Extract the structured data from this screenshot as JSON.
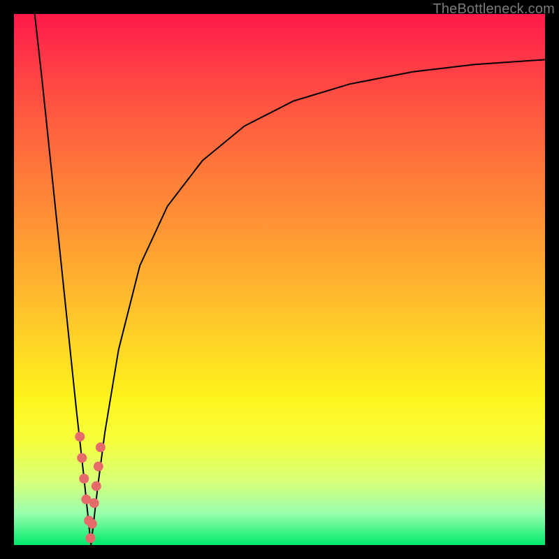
{
  "watermark": "TheBottleneck.com",
  "colors": {
    "frame": "#000000",
    "curve": "#000000",
    "marker": "#e66a6a",
    "gradient_stops": [
      "#ff1a4b",
      "#ff3348",
      "#ff5741",
      "#ff7a3a",
      "#ff9a33",
      "#ffba2d",
      "#ffd826",
      "#fff31c",
      "#f7ff3a",
      "#d8ff79",
      "#9bffae",
      "#00e96b"
    ]
  },
  "chart_data": {
    "type": "line",
    "title": "",
    "xlabel": "",
    "ylabel": "",
    "x_range": [
      0,
      100
    ],
    "y_range": [
      0,
      100
    ],
    "grid": false,
    "legend": false,
    "series": [
      {
        "name": "left-branch",
        "x": [
          3.9,
          5.3,
          6.6,
          7.9,
          9.2,
          10.5,
          11.8,
          13.2,
          14.5
        ],
        "y": [
          100,
          87.5,
          75,
          62.5,
          50,
          37.5,
          25,
          12.5,
          0
        ]
      },
      {
        "name": "right-branch",
        "x": [
          14.5,
          15.8,
          17.1,
          19.7,
          23.7,
          28.9,
          35.5,
          43.4,
          52.6,
          63.2,
          75.0,
          86.8,
          100
        ],
        "y": [
          0,
          11.2,
          21.1,
          36.8,
          52.6,
          63.8,
          72.4,
          78.9,
          83.6,
          86.8,
          89.1,
          90.5,
          91.4
        ]
      }
    ],
    "markers": {
      "name": "highlight-points",
      "x": [
        12.4,
        12.8,
        13.2,
        13.6,
        14.1,
        14.4,
        14.7,
        15.1,
        15.5,
        15.9,
        16.3
      ],
      "y": [
        20.4,
        16.4,
        12.5,
        8.6,
        4.6,
        1.3,
        4.0,
        7.9,
        11.1,
        14.8,
        18.4
      ]
    }
  }
}
